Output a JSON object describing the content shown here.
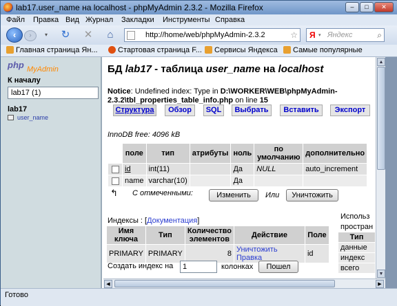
{
  "window": {
    "title": "lab17.user_name на localhost - phpMyAdmin 2.3.2 - Mozilla Firefox",
    "controls": {
      "minimize": "–",
      "maximize": "□",
      "close": "✕"
    }
  },
  "menu": [
    "Файл",
    "Правка",
    "Вид",
    "Журнал",
    "Закладки",
    "Инструменты",
    "Справка"
  ],
  "nav": {
    "url": "http://home/web/phpMyAdmin-2.3.2",
    "search_engine": "Я",
    "search_placeholder": "Яндекс"
  },
  "bookmarks": [
    "Главная страница Ян...",
    "Стартовая страница F...",
    "Сервисы Яндекса",
    "Самые популярные"
  ],
  "sidebar": {
    "logo_php": "php",
    "logo_myadmin": "MyAdmin",
    "home": "К началу",
    "db_select": "lab17 (1)",
    "db_name": "lab17",
    "table_link": "user_name"
  },
  "main": {
    "title_prefix": "БД ",
    "title_db": "lab17",
    "title_mid": " - таблица ",
    "title_table": "user_name",
    "title_on": " на ",
    "title_host": "localhost",
    "notice_label": "Notice",
    "notice_text": ": Undefined index: Type in ",
    "notice_path": "D:\\WORKER\\WEB\\phpMyAdmin-2.3.2\\tbl_properties_table_info.php",
    "notice_line_label": " on line ",
    "notice_line": "15",
    "tabs": [
      "Структура",
      "Обзор",
      "SQL",
      "Выбрать",
      "Вставить",
      "Экспорт"
    ],
    "innodb_free": "InnoDB free: 4096 kB",
    "fields_headers": [
      "поле",
      "тип",
      "атрибуты",
      "ноль",
      "по умолчанию",
      "дополнительно"
    ],
    "fields_rows": [
      {
        "field": "id",
        "type": "int(11)",
        "attributes": "",
        "null": "Да",
        "default": "NULL",
        "extra": "auto_increment"
      },
      {
        "field": "name",
        "type": "varchar(10)",
        "attributes": "",
        "null": "Да",
        "default": "",
        "extra": ""
      }
    ],
    "with_selected": "С отмеченными:",
    "change_button": "Изменить",
    "or_label": "Или",
    "drop_button": "Уничтожить",
    "indexes_label": "Индексы : [",
    "indexes_doc": "Документация",
    "indexes_close": "]",
    "index_headers": [
      "Имя ключа",
      "Тип",
      "Количество элементов",
      "Действие",
      "Поле"
    ],
    "index_rows": [
      {
        "key": "PRIMARY",
        "type": "PRIMARY",
        "count": "8",
        "action_drop": "Уничтожить",
        "action_edit": "Правка",
        "field": "id"
      }
    ],
    "space_title_1": "Использ",
    "space_title_2": "простран",
    "space_header": "Тип",
    "space_rows": [
      "данные",
      "индекс",
      "всего"
    ],
    "create_index_label": "Создать индекс на",
    "create_index_value": "1",
    "create_index_suffix": "колонках",
    "go_button": "Пошел"
  },
  "status": "Готово"
}
